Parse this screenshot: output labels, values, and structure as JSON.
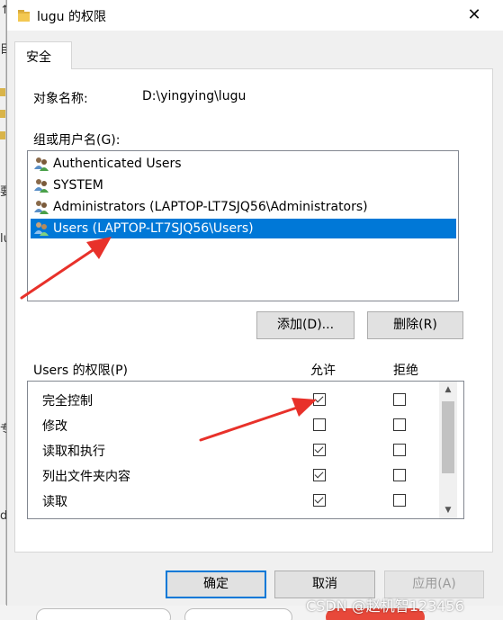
{
  "window": {
    "title": "lugu 的权限",
    "close_glyph": "✕"
  },
  "tabs": [
    {
      "label": "安全",
      "active": true
    }
  ],
  "object": {
    "label": "对象名称:",
    "value": "D:\\yingying\\lugu"
  },
  "groups": {
    "label": "组或用户名(G):",
    "items": [
      {
        "name": "Authenticated Users",
        "icon": "users-icon",
        "selected": false
      },
      {
        "name": "SYSTEM",
        "icon": "users-icon",
        "selected": false
      },
      {
        "name": "Administrators (LAPTOP-LT7SJQ56\\Administrators)",
        "icon": "users-icon",
        "selected": false
      },
      {
        "name": "Users (LAPTOP-LT7SJQ56\\Users)",
        "icon": "users-icon",
        "selected": true
      }
    ],
    "add_label": "添加(D)...",
    "remove_label": "删除(R)"
  },
  "permissions": {
    "label": "Users 的权限(P)",
    "allow_header": "允许",
    "deny_header": "拒绝",
    "rows": [
      {
        "name": "完全控制",
        "allow": true,
        "deny": false
      },
      {
        "name": "修改",
        "allow": false,
        "deny": false
      },
      {
        "name": "读取和执行",
        "allow": true,
        "deny": false
      },
      {
        "name": "列出文件夹内容",
        "allow": true,
        "deny": false
      },
      {
        "name": "读取",
        "allow": true,
        "deny": false
      }
    ]
  },
  "footer": {
    "ok_label": "确定",
    "cancel_label": "取消",
    "apply_label": "应用(A)"
  },
  "watermark": "CSDN @赵机智123456",
  "colors": {
    "selection": "#0078d7",
    "annotation_arrow": "#e8312a"
  }
}
